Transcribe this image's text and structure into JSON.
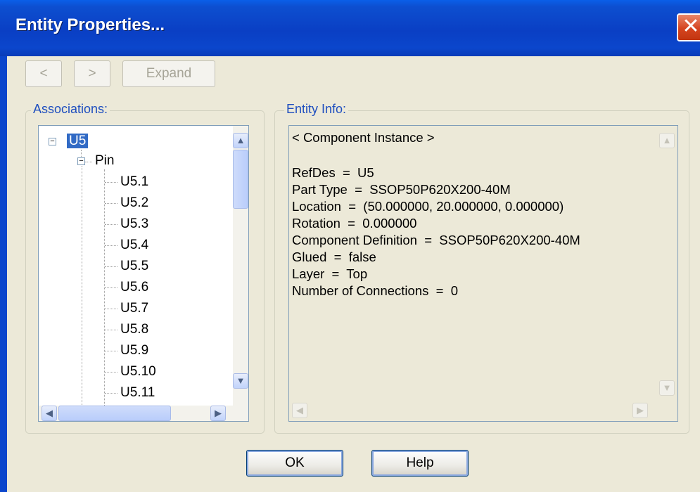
{
  "window": {
    "title": "Entity Properties...",
    "close_glyph": "✕"
  },
  "toolbar": {
    "back_label": "<",
    "forward_label": ">",
    "expand_label": "Expand"
  },
  "associations": {
    "label": "Associations:",
    "root": "U5",
    "node": "Pin",
    "pins": [
      "U5.1",
      "U5.2",
      "U5.3",
      "U5.4",
      "U5.5",
      "U5.6",
      "U5.7",
      "U5.8",
      "U5.9",
      "U5.10",
      "U5.11"
    ]
  },
  "entity_info": {
    "label": "Entity Info:",
    "lines": [
      "< Component Instance >",
      "",
      "RefDes  =  U5",
      "Part Type  =  SSOP50P620X200-40M",
      "Location  =  (50.000000, 20.000000, 0.000000)",
      "Rotation  =  0.000000",
      "Component Definition  =  SSOP50P620X200-40M",
      "Glued  =  false",
      "Layer  =  Top",
      "Number of Connections  =  0"
    ]
  },
  "buttons": {
    "ok": "OK",
    "help": "Help"
  },
  "icons": {
    "up": "▲",
    "down": "▼",
    "left": "◀",
    "right": "▶",
    "collapse": "−"
  }
}
